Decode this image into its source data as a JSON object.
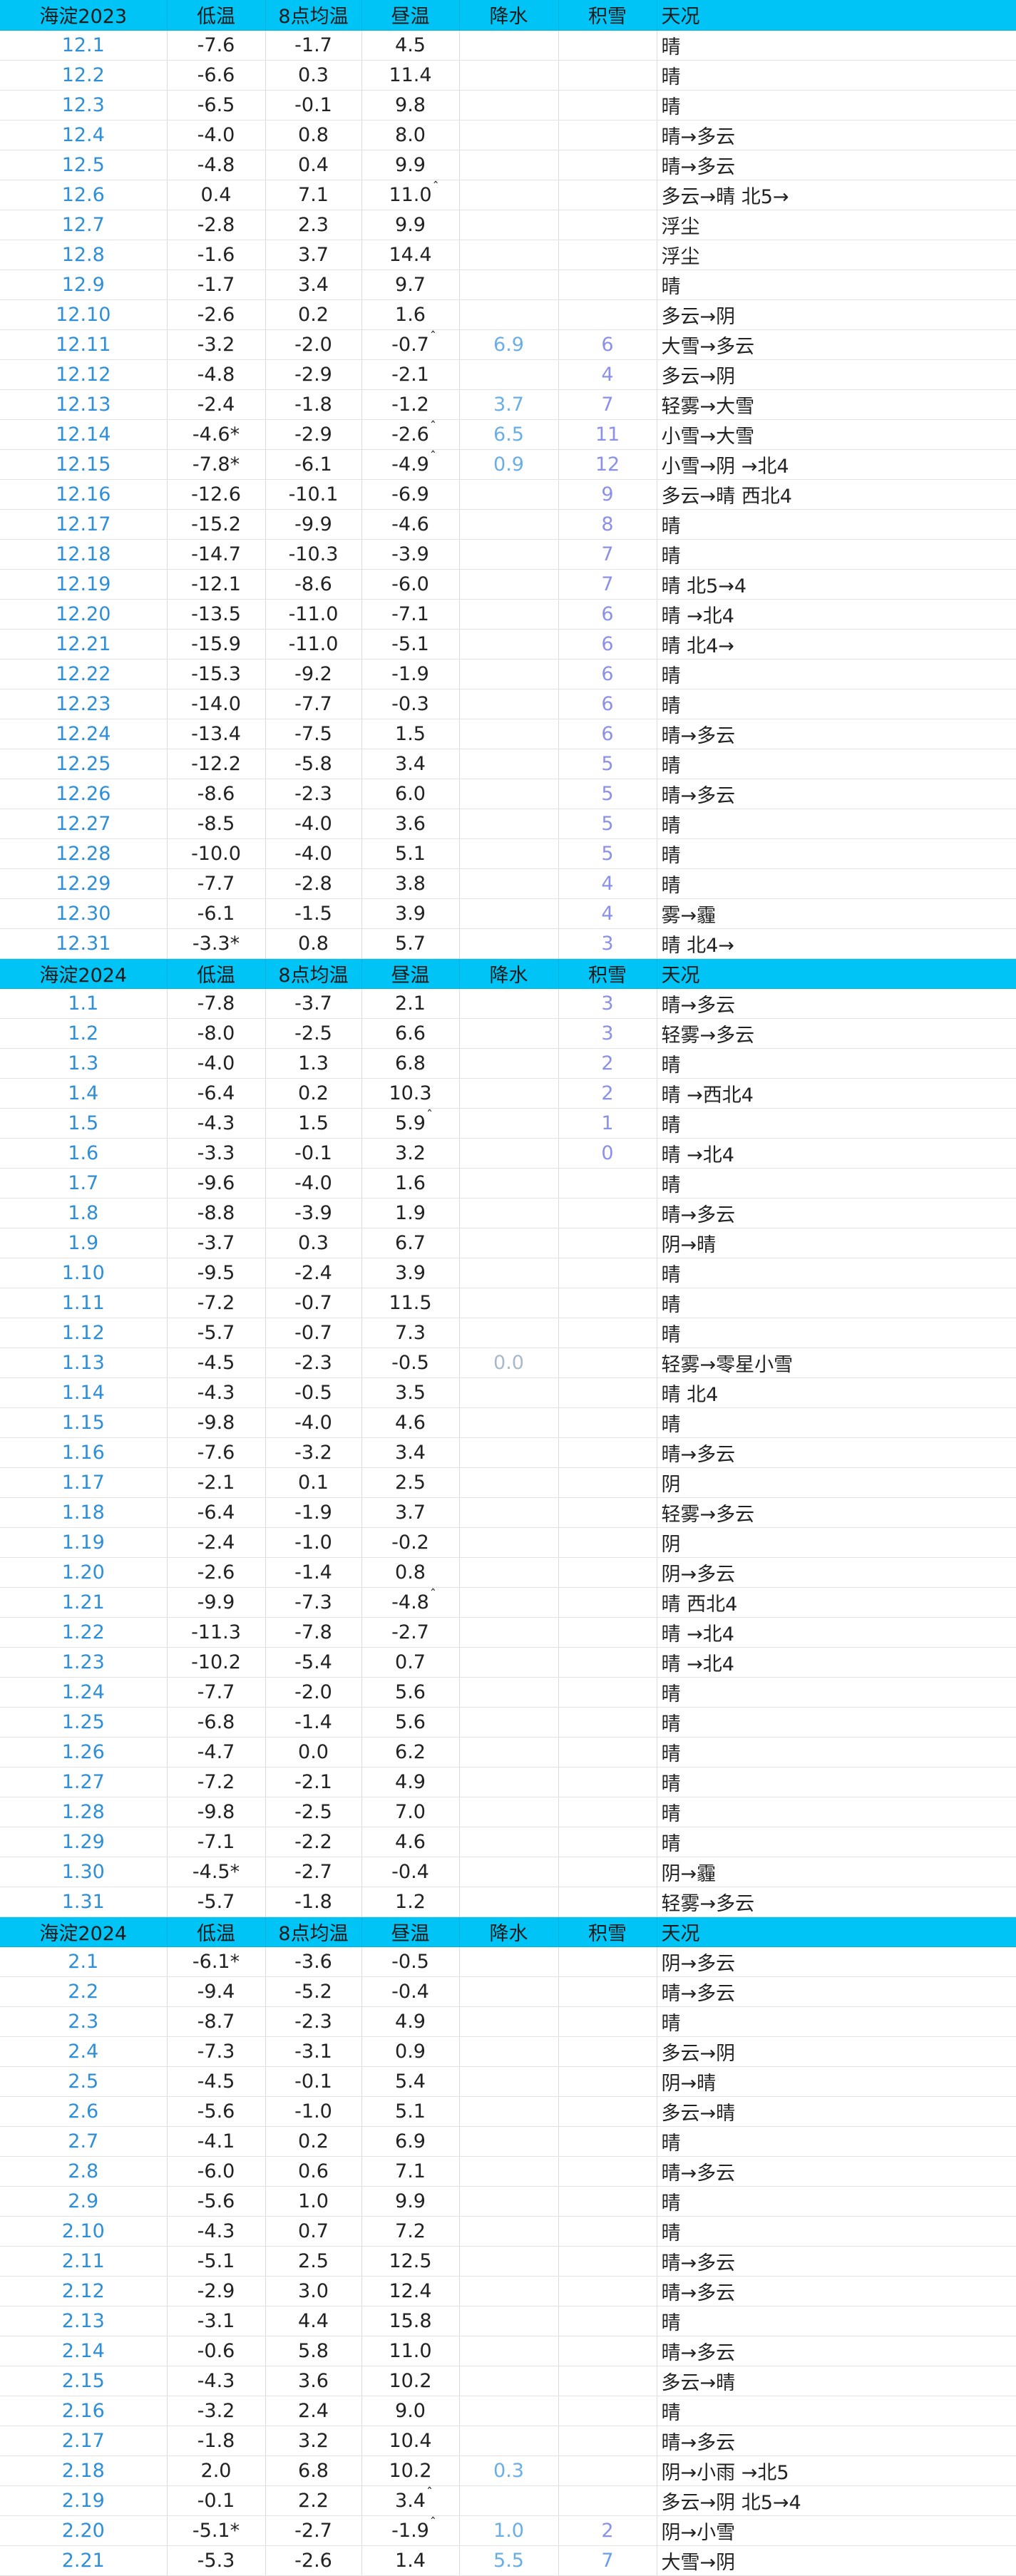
{
  "columns": [
    "低温",
    "8点均温",
    "昼温",
    "降水",
    "积雪",
    "天况"
  ],
  "sections": [
    {
      "title": "海淀2023",
      "rows": [
        {
          "date": "12.1",
          "low": "-7.6",
          "avg": "-1.7",
          "day": "4.5",
          "pr": "",
          "sn": "",
          "sky": "晴"
        },
        {
          "date": "12.2",
          "low": "-6.6",
          "avg": "0.3",
          "day": "11.4",
          "pr": "",
          "sn": "",
          "sky": "晴"
        },
        {
          "date": "12.3",
          "low": "-6.5",
          "avg": "-0.1",
          "day": "9.8",
          "pr": "",
          "sn": "",
          "sky": "晴"
        },
        {
          "date": "12.4",
          "low": "-4.0",
          "avg": "0.8",
          "day": "8.0",
          "pr": "",
          "sn": "",
          "sky": "晴→多云"
        },
        {
          "date": "12.5",
          "low": "-4.8",
          "avg": "0.4",
          "day": "9.9",
          "pr": "",
          "sn": "",
          "sky": "晴→多云"
        },
        {
          "date": "12.6",
          "low": "0.4",
          "avg": "7.1",
          "day": "11.0",
          "day_mark": "ˆ",
          "pr": "",
          "sn": "",
          "sky": "多云→晴 北5→"
        },
        {
          "date": "12.7",
          "low": "-2.8",
          "avg": "2.3",
          "day": "9.9",
          "pr": "",
          "sn": "",
          "sky": "浮尘"
        },
        {
          "date": "12.8",
          "low": "-1.6",
          "avg": "3.7",
          "day": "14.4",
          "pr": "",
          "sn": "",
          "sky": "浮尘"
        },
        {
          "date": "12.9",
          "low": "-1.7",
          "avg": "3.4",
          "day": "9.7",
          "pr": "",
          "sn": "",
          "sky": "晴"
        },
        {
          "date": "12.10",
          "low": "-2.6",
          "avg": "0.2",
          "day": "1.6",
          "pr": "",
          "sn": "",
          "sky": "多云→阴"
        },
        {
          "date": "12.11",
          "low": "-3.2",
          "avg": "-2.0",
          "day": "-0.7",
          "day_mark": "ˆ",
          "pr": "6.9",
          "sn": "6",
          "sky": "大雪→多云"
        },
        {
          "date": "12.12",
          "low": "-4.8",
          "avg": "-2.9",
          "day": "-2.1",
          "pr": "",
          "sn": "4",
          "sky": "多云→阴"
        },
        {
          "date": "12.13",
          "low": "-2.4",
          "avg": "-1.8",
          "day": "-1.2",
          "pr": "3.7",
          "sn": "7",
          "sky": "轻雾→大雪"
        },
        {
          "date": "12.14",
          "low": "-4.6*",
          "avg": "-2.9",
          "day": "-2.6",
          "day_mark": "ˆ",
          "pr": "6.5",
          "sn": "11",
          "sky": "小雪→大雪"
        },
        {
          "date": "12.15",
          "low": "-7.8*",
          "avg": "-6.1",
          "day": "-4.9",
          "day_mark": "ˆ",
          "pr": "0.9",
          "sn": "12",
          "sky": "小雪→阴 →北4"
        },
        {
          "date": "12.16",
          "low": "-12.6",
          "avg": "-10.1",
          "day": "-6.9",
          "pr": "",
          "sn": "9",
          "sky": "多云→晴 西北4"
        },
        {
          "date": "12.17",
          "low": "-15.2",
          "avg": "-9.9",
          "day": "-4.6",
          "pr": "",
          "sn": "8",
          "sky": "晴"
        },
        {
          "date": "12.18",
          "low": "-14.7",
          "avg": "-10.3",
          "day": "-3.9",
          "pr": "",
          "sn": "7",
          "sky": "晴"
        },
        {
          "date": "12.19",
          "low": "-12.1",
          "avg": "-8.6",
          "day": "-6.0",
          "pr": "",
          "sn": "7",
          "sky": "晴 北5→4"
        },
        {
          "date": "12.20",
          "low": "-13.5",
          "avg": "-11.0",
          "day": "-7.1",
          "pr": "",
          "sn": "6",
          "sky": "晴 →北4"
        },
        {
          "date": "12.21",
          "low": "-15.9",
          "avg": "-11.0",
          "day": "-5.1",
          "pr": "",
          "sn": "6",
          "sky": "晴 北4→"
        },
        {
          "date": "12.22",
          "low": "-15.3",
          "avg": "-9.2",
          "day": "-1.9",
          "pr": "",
          "sn": "6",
          "sky": "晴"
        },
        {
          "date": "12.23",
          "low": "-14.0",
          "avg": "-7.7",
          "day": "-0.3",
          "pr": "",
          "sn": "6",
          "sky": "晴"
        },
        {
          "date": "12.24",
          "low": "-13.4",
          "avg": "-7.5",
          "day": "1.5",
          "pr": "",
          "sn": "6",
          "sky": "晴→多云"
        },
        {
          "date": "12.25",
          "low": "-12.2",
          "avg": "-5.8",
          "day": "3.4",
          "pr": "",
          "sn": "5",
          "sky": "晴"
        },
        {
          "date": "12.26",
          "low": "-8.6",
          "avg": "-2.3",
          "day": "6.0",
          "pr": "",
          "sn": "5",
          "sky": "晴→多云"
        },
        {
          "date": "12.27",
          "low": "-8.5",
          "avg": "-4.0",
          "day": "3.6",
          "pr": "",
          "sn": "5",
          "sky": "晴"
        },
        {
          "date": "12.28",
          "low": "-10.0",
          "avg": "-4.0",
          "day": "5.1",
          "pr": "",
          "sn": "5",
          "sky": "晴"
        },
        {
          "date": "12.29",
          "low": "-7.7",
          "avg": "-2.8",
          "day": "3.8",
          "pr": "",
          "sn": "4",
          "sky": "晴"
        },
        {
          "date": "12.30",
          "low": "-6.1",
          "avg": "-1.5",
          "day": "3.9",
          "pr": "",
          "sn": "4",
          "sky": "雾→霾"
        },
        {
          "date": "12.31",
          "low": "-3.3*",
          "avg": "0.8",
          "day": "5.7",
          "pr": "",
          "sn": "3",
          "sky": "晴 北4→"
        }
      ]
    },
    {
      "title": "海淀2024",
      "rows": [
        {
          "date": "1.1",
          "low": "-7.8",
          "avg": "-3.7",
          "day": "2.1",
          "pr": "",
          "sn": "3",
          "sky": "晴→多云"
        },
        {
          "date": "1.2",
          "low": "-8.0",
          "avg": "-2.5",
          "day": "6.6",
          "pr": "",
          "sn": "3",
          "sky": "轻雾→多云"
        },
        {
          "date": "1.3",
          "low": "-4.0",
          "avg": "1.3",
          "day": "6.8",
          "pr": "",
          "sn": "2",
          "sky": "晴"
        },
        {
          "date": "1.4",
          "low": "-6.4",
          "avg": "0.2",
          "day": "10.3",
          "pr": "",
          "sn": "2",
          "sky": "晴 →西北4"
        },
        {
          "date": "1.5",
          "low": "-4.3",
          "avg": "1.5",
          "day": "5.9",
          "day_mark": "ˆ",
          "pr": "",
          "sn": "1",
          "sky": "晴"
        },
        {
          "date": "1.6",
          "low": "-3.3",
          "avg": "-0.1",
          "day": "3.2",
          "pr": "",
          "sn": "0",
          "sky": "晴 →北4"
        },
        {
          "date": "1.7",
          "low": "-9.6",
          "avg": "-4.0",
          "day": "1.6",
          "pr": "",
          "sn": "",
          "sky": "晴"
        },
        {
          "date": "1.8",
          "low": "-8.8",
          "avg": "-3.9",
          "day": "1.9",
          "pr": "",
          "sn": "",
          "sky": "晴→多云"
        },
        {
          "date": "1.9",
          "low": "-3.7",
          "avg": "0.3",
          "day": "6.7",
          "pr": "",
          "sn": "",
          "sky": "阴→晴"
        },
        {
          "date": "1.10",
          "low": "-9.5",
          "avg": "-2.4",
          "day": "3.9",
          "pr": "",
          "sn": "",
          "sky": "晴"
        },
        {
          "date": "1.11",
          "low": "-7.2",
          "avg": "-0.7",
          "day": "11.5",
          "pr": "",
          "sn": "",
          "sky": "晴"
        },
        {
          "date": "1.12",
          "low": "-5.7",
          "avg": "-0.7",
          "day": "7.3",
          "pr": "",
          "sn": "",
          "sky": "晴"
        },
        {
          "date": "1.13",
          "low": "-4.5",
          "avg": "-2.3",
          "day": "-0.5",
          "pr": "0.0",
          "pr_gray": true,
          "sn": "",
          "sky": "轻雾→零星小雪"
        },
        {
          "date": "1.14",
          "low": "-4.3",
          "avg": "-0.5",
          "day": "3.5",
          "pr": "",
          "sn": "",
          "sky": "晴 北4"
        },
        {
          "date": "1.15",
          "low": "-9.8",
          "avg": "-4.0",
          "day": "4.6",
          "pr": "",
          "sn": "",
          "sky": "晴"
        },
        {
          "date": "1.16",
          "low": "-7.6",
          "avg": "-3.2",
          "day": "3.4",
          "pr": "",
          "sn": "",
          "sky": "晴→多云"
        },
        {
          "date": "1.17",
          "low": "-2.1",
          "avg": "0.1",
          "day": "2.5",
          "pr": "",
          "sn": "",
          "sky": "阴"
        },
        {
          "date": "1.18",
          "low": "-6.4",
          "avg": "-1.9",
          "day": "3.7",
          "pr": "",
          "sn": "",
          "sky": "轻雾→多云"
        },
        {
          "date": "1.19",
          "low": "-2.4",
          "avg": "-1.0",
          "day": "-0.2",
          "pr": "",
          "sn": "",
          "sky": "阴"
        },
        {
          "date": "1.20",
          "low": "-2.6",
          "avg": "-1.4",
          "day": "0.8",
          "pr": "",
          "sn": "",
          "sky": "阴→多云"
        },
        {
          "date": "1.21",
          "low": "-9.9",
          "avg": "-7.3",
          "day": "-4.8",
          "day_mark": "ˆ",
          "pr": "",
          "sn": "",
          "sky": "晴 西北4"
        },
        {
          "date": "1.22",
          "low": "-11.3",
          "avg": "-7.8",
          "day": "-2.7",
          "pr": "",
          "sn": "",
          "sky": "晴 →北4"
        },
        {
          "date": "1.23",
          "low": "-10.2",
          "avg": "-5.4",
          "day": "0.7",
          "pr": "",
          "sn": "",
          "sky": "晴 →北4"
        },
        {
          "date": "1.24",
          "low": "-7.7",
          "avg": "-2.0",
          "day": "5.6",
          "pr": "",
          "sn": "",
          "sky": "晴"
        },
        {
          "date": "1.25",
          "low": "-6.8",
          "avg": "-1.4",
          "day": "5.6",
          "pr": "",
          "sn": "",
          "sky": "晴"
        },
        {
          "date": "1.26",
          "low": "-4.7",
          "avg": "0.0",
          "day": "6.2",
          "pr": "",
          "sn": "",
          "sky": "晴"
        },
        {
          "date": "1.27",
          "low": "-7.2",
          "avg": "-2.1",
          "day": "4.9",
          "pr": "",
          "sn": "",
          "sky": "晴"
        },
        {
          "date": "1.28",
          "low": "-9.8",
          "avg": "-2.5",
          "day": "7.0",
          "pr": "",
          "sn": "",
          "sky": "晴"
        },
        {
          "date": "1.29",
          "low": "-7.1",
          "avg": "-2.2",
          "day": "4.6",
          "pr": "",
          "sn": "",
          "sky": "晴"
        },
        {
          "date": "1.30",
          "low": "-4.5*",
          "avg": "-2.7",
          "day": "-0.4",
          "pr": "",
          "sn": "",
          "sky": "阴→霾"
        },
        {
          "date": "1.31",
          "low": "-5.7",
          "avg": "-1.8",
          "day": "1.2",
          "pr": "",
          "sn": "",
          "sky": "轻雾→多云"
        }
      ]
    },
    {
      "title": "海淀2024",
      "rows": [
        {
          "date": "2.1",
          "low": "-6.1*",
          "avg": "-3.6",
          "day": "-0.5",
          "pr": "",
          "sn": "",
          "sky": "阴→多云"
        },
        {
          "date": "2.2",
          "low": "-9.4",
          "avg": "-5.2",
          "day": "-0.4",
          "pr": "",
          "sn": "",
          "sky": "晴→多云"
        },
        {
          "date": "2.3",
          "low": "-8.7",
          "avg": "-2.3",
          "day": "4.9",
          "pr": "",
          "sn": "",
          "sky": "晴"
        },
        {
          "date": "2.4",
          "low": "-7.3",
          "avg": "-3.1",
          "day": "0.9",
          "pr": "",
          "sn": "",
          "sky": "多云→阴"
        },
        {
          "date": "2.5",
          "low": "-4.5",
          "avg": "-0.1",
          "day": "5.4",
          "pr": "",
          "sn": "",
          "sky": "阴→晴"
        },
        {
          "date": "2.6",
          "low": "-5.6",
          "avg": "-1.0",
          "day": "5.1",
          "pr": "",
          "sn": "",
          "sky": "多云→晴"
        },
        {
          "date": "2.7",
          "low": "-4.1",
          "avg": "0.2",
          "day": "6.9",
          "pr": "",
          "sn": "",
          "sky": "晴"
        },
        {
          "date": "2.8",
          "low": "-6.0",
          "avg": "0.6",
          "day": "7.1",
          "pr": "",
          "sn": "",
          "sky": "晴→多云"
        },
        {
          "date": "2.9",
          "low": "-5.6",
          "avg": "1.0",
          "day": "9.9",
          "pr": "",
          "sn": "",
          "sky": "晴"
        },
        {
          "date": "2.10",
          "low": "-4.3",
          "avg": "0.7",
          "day": "7.2",
          "pr": "",
          "sn": "",
          "sky": "晴"
        },
        {
          "date": "2.11",
          "low": "-5.1",
          "avg": "2.5",
          "day": "12.5",
          "pr": "",
          "sn": "",
          "sky": "晴→多云"
        },
        {
          "date": "2.12",
          "low": "-2.9",
          "avg": "3.0",
          "day": "12.4",
          "pr": "",
          "sn": "",
          "sky": "晴→多云"
        },
        {
          "date": "2.13",
          "low": "-3.1",
          "avg": "4.4",
          "day": "15.8",
          "pr": "",
          "sn": "",
          "sky": "晴"
        },
        {
          "date": "2.14",
          "low": "-0.6",
          "avg": "5.8",
          "day": "11.0",
          "pr": "",
          "sn": "",
          "sky": "晴→多云"
        },
        {
          "date": "2.15",
          "low": "-4.3",
          "avg": "3.6",
          "day": "10.2",
          "pr": "",
          "sn": "",
          "sky": "多云→晴"
        },
        {
          "date": "2.16",
          "low": "-3.2",
          "avg": "2.4",
          "day": "9.0",
          "pr": "",
          "sn": "",
          "sky": "晴"
        },
        {
          "date": "2.17",
          "low": "-1.8",
          "avg": "3.2",
          "day": "10.4",
          "pr": "",
          "sn": "",
          "sky": "晴→多云"
        },
        {
          "date": "2.18",
          "low": "2.0",
          "avg": "6.8",
          "day": "10.2",
          "pr": "0.3",
          "sn": "",
          "sky": "阴→小雨 →北5"
        },
        {
          "date": "2.19",
          "low": "-0.1",
          "avg": "2.2",
          "day": "3.4",
          "day_mark": "ˆ",
          "pr": "",
          "sn": "",
          "sky": "多云→阴 北5→4"
        },
        {
          "date": "2.20",
          "low": "-5.1*",
          "avg": "-2.7",
          "day": "-1.9",
          "day_mark": "ˆ",
          "pr": "1.0",
          "sn": "2",
          "sky": "阴→小雪"
        },
        {
          "date": "2.21",
          "low": "-5.3",
          "avg": "-2.6",
          "day": "1.4",
          "pr": "5.5",
          "sn": "7",
          "sn_blue": true,
          "sky": "大雪→阴"
        }
      ]
    }
  ]
}
